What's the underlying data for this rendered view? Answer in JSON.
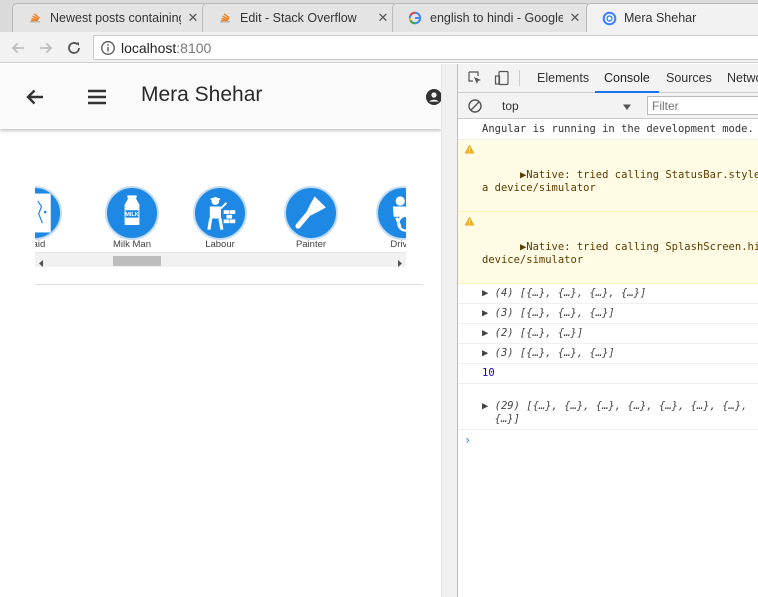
{
  "browser": {
    "tabs": [
      {
        "title": "Newest posts containing",
        "icon": "stackoverflow-icon",
        "active": false
      },
      {
        "title": "Edit - Stack Overflow",
        "icon": "stackoverflow-icon",
        "active": false
      },
      {
        "title": "english to hindi - Google",
        "icon": "google-icon",
        "active": false
      },
      {
        "title": "Mera Shehar",
        "icon": "ionic-icon",
        "active": true
      }
    ],
    "address": {
      "host": "localhost",
      "port": ":8100"
    }
  },
  "app": {
    "title": "Mera Shehar",
    "categories": [
      {
        "label": "Maid",
        "icon": "maid-icon"
      },
      {
        "label": "Milk Man",
        "icon": "milk-carton-icon",
        "badge": "MILK"
      },
      {
        "label": "Labour",
        "icon": "labourer-icon"
      },
      {
        "label": "Painter",
        "icon": "paint-brush-icon"
      },
      {
        "label": "Driver",
        "icon": "driver-icon"
      }
    ],
    "accent_color": "#1e88e5",
    "hscroll": {
      "thumb_position": 0.22,
      "thumb_fraction": 0.14
    }
  },
  "devtools": {
    "tabs": [
      "Elements",
      "Console",
      "Sources",
      "Network"
    ],
    "active_tab": "Console",
    "context": "top",
    "filter_placeholder": "Filter",
    "console": [
      {
        "type": "log",
        "text": "Angular is running in the development mode."
      },
      {
        "type": "warn",
        "text": "▶Native: tried calling StatusBar.styleDefault,\na device/simulator"
      },
      {
        "type": "warn",
        "text": "▶Native: tried calling SplashScreen.hide, but\ndevice/simulator"
      },
      {
        "type": "obj",
        "text": "▶ (4) [{…}, {…}, {…}, {…}]"
      },
      {
        "type": "obj",
        "text": "▶ (3) [{…}, {…}, {…}]"
      },
      {
        "type": "obj",
        "text": "▶ (2) [{…}, {…}]"
      },
      {
        "type": "obj",
        "text": "▶ (3) [{…}, {…}, {…}]"
      },
      {
        "type": "num",
        "text": "10"
      },
      {
        "type": "obj",
        "text": "\n▶ (29) [{…}, {…}, {…}, {…}, {…}, {…}, {…},\n  {…}]"
      }
    ],
    "prompt": "›"
  }
}
